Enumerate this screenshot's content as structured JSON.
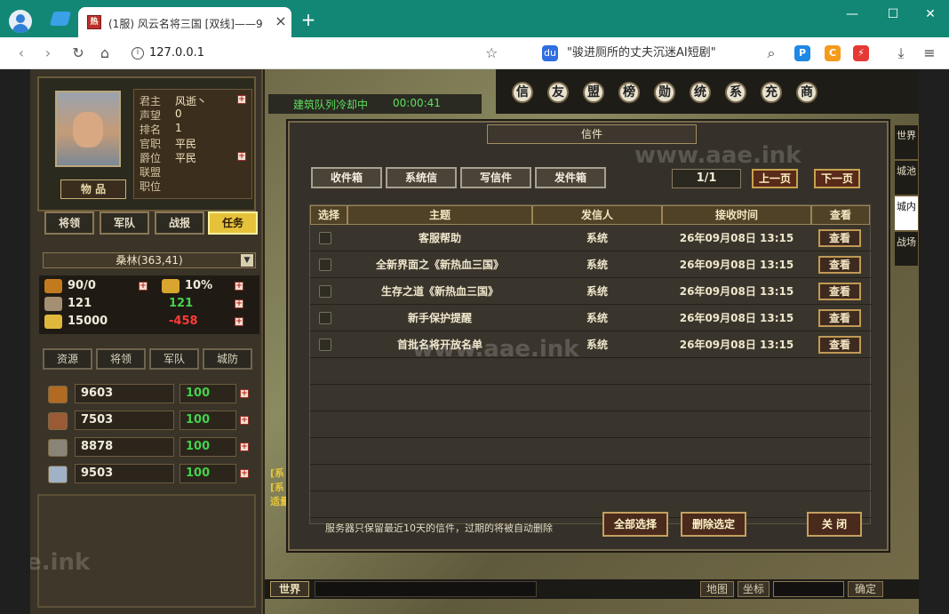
{
  "browser": {
    "tab_title": "(1服) 风云名将三国 [双线]——9",
    "favicon_text": "热",
    "url": "127.0.0.1",
    "search_text": "\"骏进厕所的丈夫沉迷AI短剧\"",
    "win_min": "—",
    "win_max": "☐",
    "win_close": "✕"
  },
  "player": {
    "labels": [
      "君主",
      "声望",
      "排名",
      "官职",
      "爵位",
      "联盟",
      "职位"
    ],
    "values": [
      "风逝丶",
      "0",
      "1",
      "平民",
      "平民",
      "",
      ""
    ],
    "item_button": "物 品"
  },
  "left_tabs": [
    "将领",
    "军队",
    "战报",
    "任务"
  ],
  "location": "桑林(363,41)",
  "stats": {
    "food_ratio": "90/0",
    "tax": "10%",
    "pop": "121",
    "pop_green": "121",
    "gold": "15000",
    "gold_delta": "-458"
  },
  "resource_tabs": [
    "资源",
    "将领",
    "军队",
    "城防"
  ],
  "resources": [
    {
      "icon": "wood-icon",
      "value": "9603",
      "rate": "100"
    },
    {
      "icon": "clay-icon",
      "value": "7503",
      "rate": "100"
    },
    {
      "icon": "iron-ore-icon",
      "value": "8878",
      "rate": "100"
    },
    {
      "icon": "steel-icon",
      "value": "9503",
      "rate": "100"
    }
  ],
  "top_nav": [
    "信",
    "友",
    "盟",
    "榜",
    "勋",
    "统",
    "系",
    "充",
    "商"
  ],
  "queue": {
    "text": "建筑队列冷却中",
    "timer": "00:00:41"
  },
  "side_tabs": [
    "世界",
    "城池",
    "城内",
    "战场"
  ],
  "chat": {
    "line1": "[系",
    "line2": "[系",
    "line3": "适量"
  },
  "bottom": {
    "world": "世界",
    "map": "地图",
    "coord": "坐标",
    "confirm": "确定"
  },
  "mail": {
    "title": "信件",
    "tabs": [
      "收件箱",
      "系统信",
      "写信件",
      "发件箱"
    ],
    "page": "1/1",
    "prev": "上一页",
    "next": "下一页",
    "headers": [
      "选择",
      "主题",
      "发信人",
      "接收时间",
      "查看"
    ],
    "rows": [
      {
        "subject": "客服帮助",
        "sender": "系统",
        "time": "26年09月08日 13:15",
        "view": "查看"
      },
      {
        "subject": "全新界面之《新热血三国》",
        "sender": "系统",
        "time": "26年09月08日 13:15",
        "view": "查看"
      },
      {
        "subject": "生存之道《新热血三国》",
        "sender": "系统",
        "time": "26年09月08日 13:15",
        "view": "查看"
      },
      {
        "subject": "新手保护提醒",
        "sender": "系统",
        "time": "26年09月08日 13:15",
        "view": "查看"
      },
      {
        "subject": "首批名将开放名单",
        "sender": "系统",
        "time": "26年09月08日 13:15",
        "view": "查看"
      }
    ],
    "note": "服务器只保留最近10天的信件，过期的将被自动删除",
    "select_all": "全部选择",
    "delete_selected": "删除选定",
    "close": "关 闭"
  },
  "watermark": "www.aae.ink",
  "watermark_short": "aae.ink"
}
